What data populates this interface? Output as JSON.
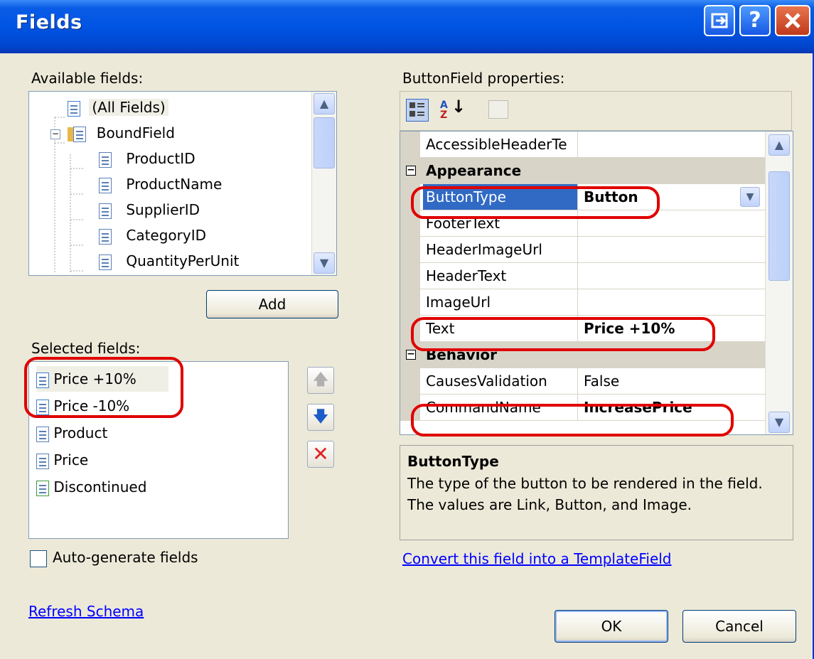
{
  "window": {
    "title": "Fields"
  },
  "available": {
    "label": "Available fields:",
    "items": [
      {
        "text": "(All Fields)",
        "level": 1
      },
      {
        "text": "BoundField",
        "level": 0
      },
      {
        "text": "ProductID",
        "level": 2
      },
      {
        "text": "ProductName",
        "level": 2
      },
      {
        "text": "SupplierID",
        "level": 2
      },
      {
        "text": "CategoryID",
        "level": 2
      },
      {
        "text": "QuantityPerUnit",
        "level": 2
      }
    ]
  },
  "add_label": "Add",
  "selected": {
    "label": "Selected fields:",
    "items": [
      "Price +10%",
      "Price -10%",
      "Product",
      "Price",
      "Discontinued"
    ]
  },
  "autogen_label": "Auto-generate fields",
  "refresh_label": "Refresh Schema",
  "properties": {
    "label": "ButtonField properties:",
    "rows": [
      {
        "name": "AccessibleHeaderTe",
        "value": "",
        "kind": "prop"
      },
      {
        "name": "Appearance",
        "value": "",
        "kind": "category"
      },
      {
        "name": "ButtonType",
        "value": "Button",
        "kind": "selected"
      },
      {
        "name": "FooterText",
        "value": "",
        "kind": "prop"
      },
      {
        "name": "HeaderImageUrl",
        "value": "",
        "kind": "prop"
      },
      {
        "name": "HeaderText",
        "value": "",
        "kind": "prop"
      },
      {
        "name": "ImageUrl",
        "value": "",
        "kind": "prop"
      },
      {
        "name": "Text",
        "value": "Price +10%",
        "kind": "bold"
      },
      {
        "name": "Behavior",
        "value": "",
        "kind": "category"
      },
      {
        "name": "CausesValidation",
        "value": "False",
        "kind": "prop"
      },
      {
        "name": "CommandName",
        "value": "IncreasePrice",
        "kind": "bold"
      }
    ]
  },
  "description": {
    "title": "ButtonType",
    "text": "The type of the button to be rendered in the field.  The values are Link, Button, and Image."
  },
  "convert_label": "Convert this field into a TemplateField",
  "ok_label": "OK",
  "cancel_label": "Cancel"
}
